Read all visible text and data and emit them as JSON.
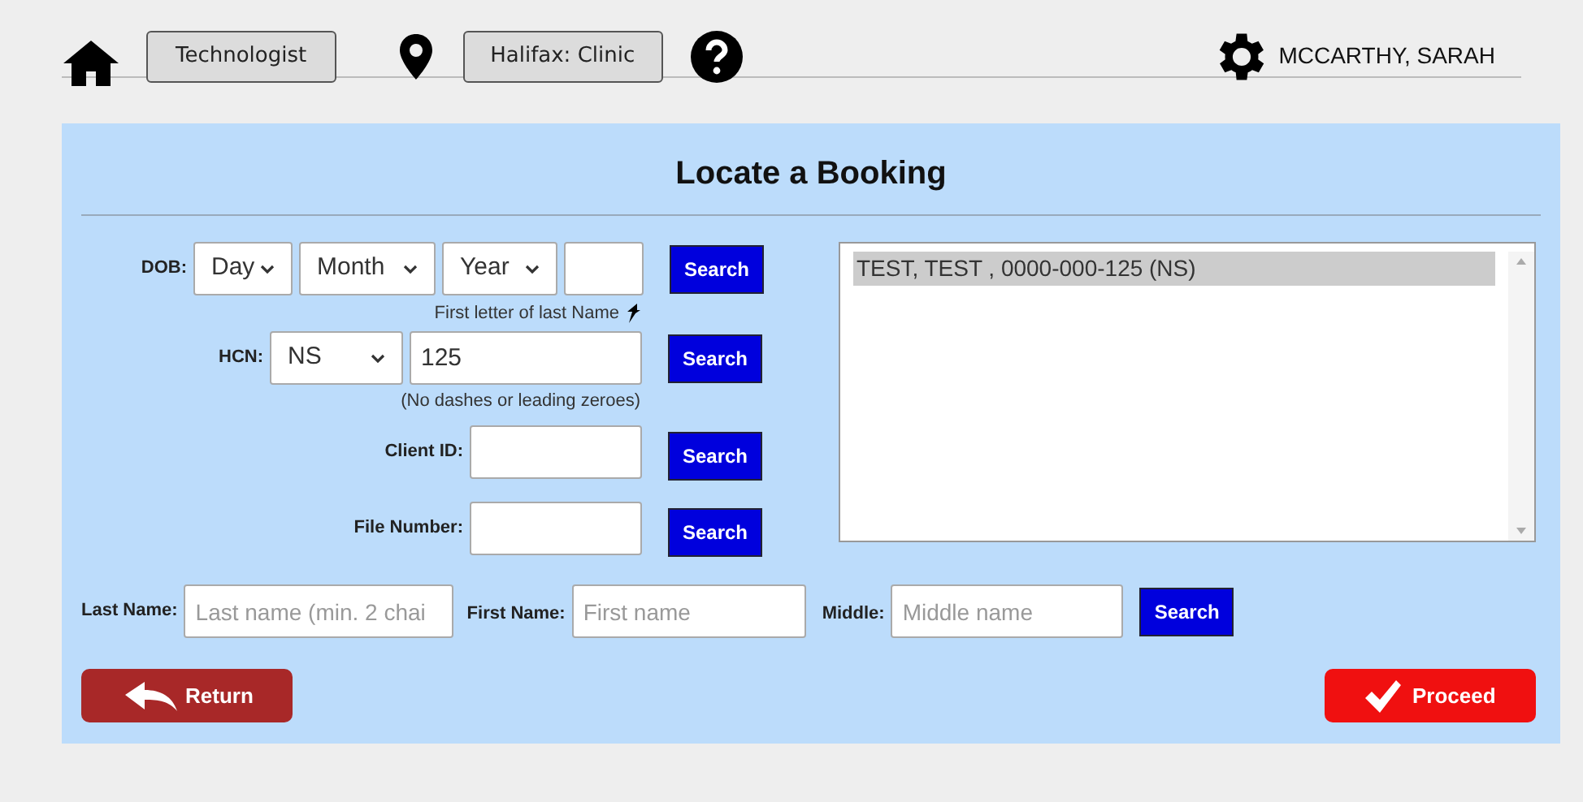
{
  "header": {
    "role_button": "Technologist",
    "location_button": "Halifax: Clinic",
    "user": "MCCARTHY, SARAH"
  },
  "title": "Locate a Booking",
  "dob": {
    "label": "DOB:",
    "day": "Day",
    "month": "Month",
    "year": "Year",
    "button": "Search"
  },
  "dob_hint": "First letter of last Name",
  "hcn": {
    "label": "HCN:",
    "province": "NS",
    "value": "125",
    "button": "Search"
  },
  "hcn_hint": "(No dashes or leading zeroes)",
  "client_id": {
    "label": "Client ID:",
    "button": "Search"
  },
  "file_number": {
    "label": "File Number:",
    "button": "Search"
  },
  "results": [
    {
      "text": "TEST, TEST , 0000-000-125 (NS)",
      "selected": true
    }
  ],
  "name_search": {
    "last_label": "Last Name:",
    "last_placeholder": "Last name (min. 2 chai",
    "first_label": "First Name:",
    "first_placeholder": "First name",
    "middle_label": "Middle:",
    "middle_placeholder": "Middle name",
    "button": "Search"
  },
  "actions": {
    "return": "Return",
    "proceed": "Proceed"
  }
}
